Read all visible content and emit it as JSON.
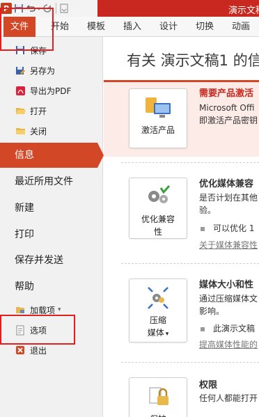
{
  "titlebar": {
    "app_icon_letter": "P",
    "title_text": "演示文稿"
  },
  "tabs": [
    "文件",
    "开始",
    "模板",
    "插入",
    "设计",
    "切换",
    "动画"
  ],
  "sidebar": {
    "save": "保存",
    "save_as": "另存为",
    "export_pdf": "导出为PDF",
    "open": "打开",
    "close": "关闭",
    "info": "信息",
    "recent": "最近所用文件",
    "new": "新建",
    "print": "打印",
    "save_send": "保存并发送",
    "help": "帮助",
    "addins": "加载项",
    "options": "选项",
    "exit": "退出"
  },
  "main": {
    "title": "有关 演示文稿1 的信",
    "activate": {
      "button": "激活产品",
      "heading": "需要产品激活",
      "line1": "Microsoft Offi",
      "line2": "即激活产品密钥"
    },
    "compat": {
      "button_line1": "优化兼容",
      "button_line2": "性",
      "heading": "优化媒体兼容",
      "line1": "是否计划在其他",
      "line2": "验。",
      "bullet": "可以优化 1",
      "link": "关于媒体兼容性"
    },
    "compress": {
      "button_line1": "压缩",
      "button_line2": "媒体",
      "heading": "媒体大小和性",
      "line1": "通过压缩媒体文",
      "line2": "影响。",
      "bullet": "此演示文稿",
      "link": "提高媒体性能的"
    },
    "permissions": {
      "button": "保护",
      "heading": "权限",
      "line1": "任何人都能打开"
    }
  },
  "colors": {
    "accent": "#d24726",
    "title_red": "#c8281f",
    "highlight": "#e02020"
  }
}
